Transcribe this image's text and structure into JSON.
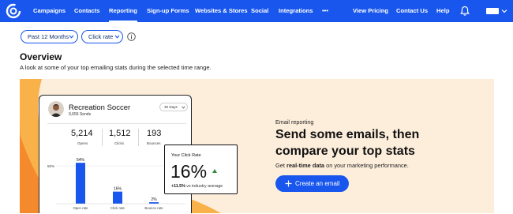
{
  "nav": {
    "items": [
      "Campaigns",
      "Contacts",
      "Reporting",
      "Sign-up Forms",
      "Websites & Stores",
      "Social",
      "Integrations",
      "•••"
    ],
    "active_index": 2,
    "right_items": [
      "View Pricing",
      "Contact Us",
      "Help"
    ],
    "icons": [
      "logo-icon",
      "bell-icon",
      "account-avatar",
      "chevron-down-icon"
    ]
  },
  "filters": {
    "period": "Past 12 Months",
    "metric": "Click rate"
  },
  "overview": {
    "title": "Overview",
    "subtitle": "A look at some of your top emailing stats during the selected time range."
  },
  "preview_card": {
    "title": "Recreation Soccer",
    "sends": "9,656 Sends",
    "range": "30 Days",
    "stats": [
      {
        "value": "5,214",
        "label": "Opens"
      },
      {
        "value": "1,512",
        "label": "Clicks"
      },
      {
        "value": "193",
        "label": "Bounces"
      }
    ],
    "axis_label": "50%",
    "bars": [
      {
        "label": "Open rate",
        "value_text": "54%",
        "value": 54
      },
      {
        "label": "Click rate",
        "value_text": "16%",
        "value": 16
      },
      {
        "label": "Bounce rate",
        "value_text": "2%",
        "value": 2
      }
    ]
  },
  "click_card": {
    "title": "Your Click Rate",
    "value": "16%",
    "delta": "+11.5%",
    "vs_text": " vs industry average"
  },
  "promo": {
    "eyebrow": "Email reporting",
    "headline_line1": "Send some emails, then",
    "headline_line2": "compare your top stats",
    "sub_bold": "real-time data",
    "sub_prefix": "Get ",
    "sub_suffix": " on your marketing performance.",
    "cta": "Create an email"
  },
  "colors": {
    "brand": "#1856ed",
    "hero_bg": "#fdeedc",
    "accent_green": "#2e8b3c"
  }
}
